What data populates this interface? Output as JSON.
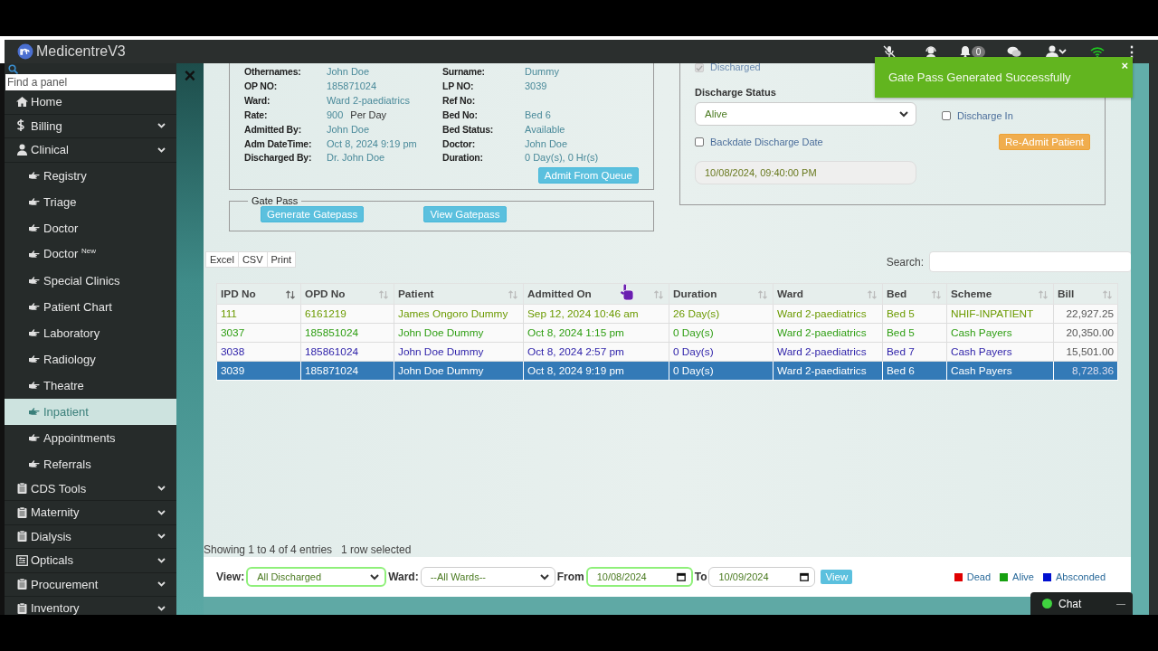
{
  "app": {
    "name": "MedicentreV3"
  },
  "topbar": {
    "notification_count": "0",
    "menu_glyph": "⋮"
  },
  "sidebar": {
    "search_placeholder": "Find a panel",
    "close_glyph": "×",
    "items": [
      {
        "label": "Home",
        "has_submenu": false
      },
      {
        "label": "Billing",
        "has_submenu": true
      },
      {
        "label": "Clinical",
        "has_submenu": true,
        "children": [
          {
            "label": "Registry",
            "selected": false
          },
          {
            "label": "Triage",
            "selected": false
          },
          {
            "label": "Doctor",
            "selected": false
          },
          {
            "label": "Doctor $^{New}$",
            "selected": false
          },
          {
            "label": "Special Clinics",
            "selected": false
          },
          {
            "label": "Patient Chart",
            "selected": false
          },
          {
            "label": "Laboratory",
            "selected": false
          },
          {
            "label": "Radiology",
            "selected": false
          },
          {
            "label": "Theatre",
            "selected": false
          },
          {
            "label": "Inpatient",
            "selected": true
          },
          {
            "label": "Appointments",
            "selected": false
          },
          {
            "label": "Referrals",
            "selected": false
          }
        ]
      },
      {
        "label": "CDS Tools",
        "has_submenu": true
      },
      {
        "label": "Maternity",
        "has_submenu": true
      },
      {
        "label": "Dialysis",
        "has_submenu": true
      },
      {
        "label": "Opticals",
        "has_submenu": true
      },
      {
        "label": "Procurement",
        "has_submenu": true
      },
      {
        "label": "Inventory",
        "has_submenu": true
      }
    ]
  },
  "admission": {
    "rows": [
      [
        {
          "label": "Othernames:",
          "value": "John Doe"
        },
        {
          "label": "Surname:",
          "value": "Dummy"
        }
      ],
      [
        {
          "label": "OP NO:",
          "value": "185871024"
        },
        {
          "label": "LP NO:",
          "value": "3039"
        }
      ],
      [
        {
          "label": "Ward:",
          "value": "Ward 2-paediatrics"
        },
        {
          "label": "Ref No:"
        }
      ],
      [
        {
          "label": "Rate:",
          "value": "900",
          "unit": "Per Day"
        },
        {
          "label": "Bed No:",
          "value": "Bed 6"
        }
      ],
      [
        {
          "label": "Admitted By:",
          "value": "John Doe"
        },
        {
          "label": "Bed Status:",
          "value": "Available"
        }
      ],
      [
        {
          "label": "Adm DateTime:",
          "value": "Oct 8, 2024 9:19 pm"
        },
        {
          "label": "Doctor:",
          "value": "John Doe"
        }
      ],
      [
        {
          "label": "Discharged By:",
          "value": "Dr. John Doe"
        },
        {
          "label": "Duration:",
          "value": "0 Day(s), 0 Hr(s)"
        }
      ]
    ],
    "button": "Admit From Queue"
  },
  "gate_pass": {
    "legend": "Gate Pass",
    "buttons": [
      "Generate Gatepass",
      "View Gatepass"
    ]
  },
  "discharge": {
    "discharged": {
      "label": "Discharged",
      "checked": true,
      "disabled": true
    },
    "status_label": "Discharge Status",
    "status_value": "Alive",
    "backdate": {
      "label": "Backdate Discharge Date",
      "checked": false
    },
    "datetime": "10/08/2024, 09:40:00 PM",
    "discharge_in": {
      "label": "Discharge In",
      "checked": false
    },
    "readmit_button": "Re-Admit Patient"
  },
  "table": {
    "export_buttons": [
      "Excel",
      "CSV",
      "Print"
    ],
    "search_label": "Search:",
    "columns": [
      {
        "label": "IPD No",
        "sorted": true
      },
      {
        "label": "OPD No",
        "sorted": false
      },
      {
        "label": "Patient",
        "sorted": false
      },
      {
        "label": "Admitted On",
        "sorted": false
      },
      {
        "label": "Duration",
        "sorted": false
      },
      {
        "label": "Ward",
        "sorted": false
      },
      {
        "label": "Bed",
        "sorted": false
      },
      {
        "label": "Scheme",
        "sorted": false
      },
      {
        "label": "Bill",
        "sorted": false
      }
    ],
    "rows": [
      {
        "color": "#6b9a00",
        "selected": false,
        "cells": [
          "111",
          "6161219",
          "James Ongoro Dummy",
          "Sep 12, 2024 10:46 am",
          "26 Day(s)",
          "Ward 2-paediatrics",
          "Bed 5",
          "NHIF-INPATIENT",
          "22,927.25"
        ]
      },
      {
        "color": "#2e9e12",
        "selected": false,
        "cells": [
          "3037",
          "185851024",
          "John Doe Dummy",
          "Oct 8, 2024 1:15 pm",
          "0 Day(s)",
          "Ward 2-paediatrics",
          "Bed 5",
          "Cash Payers",
          "20,350.00"
        ]
      },
      {
        "color": "#2b1ea8",
        "selected": false,
        "cells": [
          "3038",
          "185861024",
          "John Doe Dummy",
          "Oct 8, 2024 2:57 pm",
          "0 Day(s)",
          "Ward 2-paediatrics",
          "Bed 7",
          "Cash Payers",
          "15,501.00"
        ]
      },
      {
        "selected": true,
        "cells": [
          "3039",
          "185871024",
          "John Doe Dummy",
          "Oct 8, 2024 9:19 pm",
          "0 Day(s)",
          "Ward 2-paediatrics",
          "Bed 6",
          "Cash Payers",
          "8,728.36"
        ]
      }
    ],
    "info": "Showing 1 to 4 of 4 entries",
    "selection_info": "1 row selected"
  },
  "filters": {
    "view_label": "View:",
    "view_value": "All Discharged",
    "view_highlighted": true,
    "ward_label": "Ward:",
    "ward_value": "--All Wards--",
    "ward_highlighted": false,
    "from_label": "From",
    "from_value": "10/08/2024",
    "from_highlighted": true,
    "to_label": "To",
    "to_value": "10/09/2024",
    "to_highlighted": false,
    "button": "View",
    "legend": [
      {
        "label": "Dead",
        "color": "#e00000"
      },
      {
        "label": "Alive",
        "color": "#16a010"
      },
      {
        "label": "Absconded",
        "color": "#0010d0"
      }
    ]
  },
  "toast": {
    "message": "Gate Pass Generated Successfully",
    "close": "×"
  },
  "chat": {
    "label": "Chat",
    "minimize": "—"
  }
}
